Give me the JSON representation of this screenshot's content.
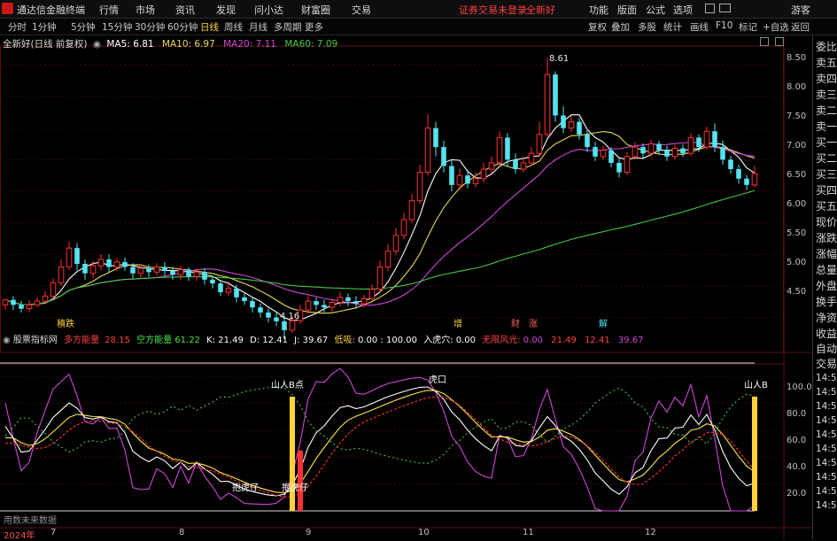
{
  "titlebar": {
    "app_name": "通达信金融终端",
    "menus": [
      "行情",
      "市场",
      "资讯",
      "发现",
      "问小达",
      "财富圈",
      "交易"
    ],
    "alert": "证券交易未登录",
    "stock": "全新好",
    "right_menus": [
      "功能",
      "版面",
      "公式",
      "选项"
    ],
    "user": "游客"
  },
  "toolbar": {
    "periods": [
      "分时",
      "1分钟",
      "5分钟",
      "15分钟",
      "30分钟",
      "60分钟",
      "日线",
      "周线",
      "月线",
      "多周期",
      "更多"
    ],
    "active_period": "日线",
    "right_buttons": [
      "复权",
      "叠加",
      "多股",
      "统计",
      "画线",
      "F10",
      "标记",
      "+自选",
      "返回"
    ]
  },
  "legend_main": {
    "title": "全新好(日线 前复权)",
    "ma5": "MA5: 6.81",
    "ma10": "MA10: 6.97",
    "ma20": "MA20: 7.11",
    "ma60": "MA60: 7.09"
  },
  "legend_ind": {
    "name": "股票指标网",
    "a_label": "多方能量",
    "a_val": "28.15",
    "b_label": "空方能量",
    "b_val": "61.22",
    "k": "K: 21.49",
    "d": "D: 12.41",
    "j": "J: 39.67",
    "low_label": "低吸:",
    "low_val": "0.00",
    "low_val2": ": 100.00",
    "entry_label": "入虎穴:",
    "entry_val": "0.00",
    "risk_label": "无限风光:",
    "risk_val": "0.00",
    "v1": "21.49",
    "v2": "12.41",
    "v3": "39.67"
  },
  "right_panel": {
    "top": [
      "委比",
      "卖五",
      "卖四",
      "卖三",
      "卖二",
      "卖一",
      "买一",
      "买二",
      "买三",
      "买四",
      "买五",
      "现价",
      "涨跌",
      "涨幅",
      "总量",
      "外盘",
      "换手",
      "净资",
      "收益"
    ],
    "bottom": [
      "自动",
      "交易"
    ],
    "times": [
      "14:55",
      "14:55",
      "14:55",
      "14:55",
      "14:55",
      "14:55",
      "14:55",
      "14:55",
      "14:55",
      "14:55"
    ]
  },
  "markers": {
    "event1": "積跌",
    "event2": "增",
    "event3": "财",
    "event4": "涨",
    "event5": "解",
    "high_label": "8.61",
    "low_label": "4.16",
    "sig1": "山人B点",
    "sig2": "山人B",
    "sig3": "抱虎仔",
    "sig4": "抱虎仔",
    "sig5": "虎口",
    "footer": "用数未来数据"
  },
  "chart_data": [
    {
      "type": "candlestick",
      "title": "全新好(日线 前复权)",
      "ylim": [
        4.2,
        8.8
      ],
      "y_ticks": [
        4.5,
        5.0,
        5.5,
        6.0,
        6.5,
        7.0,
        7.5,
        8.0,
        8.5
      ],
      "annotations": [
        {
          "label": "8.61",
          "value": 8.61
        },
        {
          "label": "4.16",
          "value": 4.16
        }
      ],
      "series": [
        {
          "name": "MA5",
          "color": "#ffffff"
        },
        {
          "name": "MA10",
          "color": "#e8d85a"
        },
        {
          "name": "MA20",
          "color": "#d046d8"
        },
        {
          "name": "MA60",
          "color": "#46c846"
        }
      ],
      "candles": [
        [
          4.7,
          4.78,
          4.62,
          4.8
        ],
        [
          4.78,
          4.7,
          4.62,
          4.84
        ],
        [
          4.7,
          4.64,
          4.58,
          4.76
        ],
        [
          4.64,
          4.7,
          4.58,
          4.78
        ],
        [
          4.7,
          4.76,
          4.66,
          4.82
        ],
        [
          4.76,
          4.84,
          4.72,
          4.92
        ],
        [
          4.84,
          5.05,
          4.8,
          5.12
        ],
        [
          5.05,
          5.3,
          5.0,
          5.42
        ],
        [
          5.3,
          5.6,
          5.25,
          5.7
        ],
        [
          5.6,
          5.35,
          5.25,
          5.68
        ],
        [
          5.35,
          5.2,
          5.1,
          5.42
        ],
        [
          5.2,
          5.32,
          5.12,
          5.4
        ],
        [
          5.32,
          5.42,
          5.25,
          5.5
        ],
        [
          5.42,
          5.3,
          5.22,
          5.5
        ],
        [
          5.3,
          5.38,
          5.24,
          5.44
        ],
        [
          5.38,
          5.3,
          5.24,
          5.45
        ],
        [
          5.3,
          5.2,
          5.12,
          5.36
        ],
        [
          5.2,
          5.28,
          5.12,
          5.34
        ],
        [
          5.28,
          5.22,
          5.14,
          5.34
        ],
        [
          5.22,
          5.3,
          5.16,
          5.36
        ],
        [
          5.3,
          5.24,
          5.16,
          5.38
        ],
        [
          5.24,
          5.18,
          5.1,
          5.3
        ],
        [
          5.18,
          5.26,
          5.1,
          5.32
        ],
        [
          5.26,
          5.15,
          5.08,
          5.3
        ],
        [
          5.15,
          5.22,
          5.08,
          5.28
        ],
        [
          5.22,
          5.1,
          5.02,
          5.28
        ],
        [
          5.1,
          5.04,
          4.96,
          5.16
        ],
        [
          5.04,
          4.9,
          4.84,
          5.1
        ],
        [
          4.9,
          4.96,
          4.84,
          5.04
        ],
        [
          4.96,
          4.82,
          4.74,
          5.02
        ],
        [
          4.82,
          4.76,
          4.7,
          4.9
        ],
        [
          4.76,
          4.66,
          4.58,
          4.82
        ],
        [
          4.66,
          4.58,
          4.5,
          4.72
        ],
        [
          4.58,
          4.5,
          4.42,
          4.64
        ],
        [
          4.5,
          4.44,
          4.36,
          4.58
        ],
        [
          4.44,
          4.3,
          4.16,
          4.5
        ],
        [
          4.3,
          4.45,
          4.26,
          4.52
        ],
        [
          4.45,
          4.62,
          4.4,
          4.7
        ],
        [
          4.62,
          4.76,
          4.56,
          4.84
        ],
        [
          4.76,
          4.7,
          4.62,
          4.82
        ],
        [
          4.7,
          4.66,
          4.58,
          4.78
        ],
        [
          4.66,
          4.74,
          4.6,
          4.8
        ],
        [
          4.74,
          4.82,
          4.68,
          4.9
        ],
        [
          4.82,
          4.76,
          4.68,
          4.88
        ],
        [
          4.76,
          4.72,
          4.64,
          4.84
        ],
        [
          4.72,
          4.8,
          4.66,
          4.86
        ],
        [
          4.8,
          4.95,
          4.76,
          5.02
        ],
        [
          4.95,
          5.3,
          4.9,
          5.4
        ],
        [
          5.3,
          5.55,
          5.24,
          5.66
        ],
        [
          5.55,
          5.8,
          5.5,
          5.92
        ],
        [
          5.8,
          6.05,
          5.74,
          6.16
        ],
        [
          6.05,
          6.35,
          6.0,
          6.46
        ],
        [
          6.35,
          6.8,
          6.3,
          6.92
        ],
        [
          6.8,
          7.5,
          6.75,
          7.72
        ],
        [
          7.5,
          7.2,
          7.05,
          7.6
        ],
        [
          7.2,
          6.9,
          6.8,
          7.3
        ],
        [
          6.9,
          6.6,
          6.5,
          7.0
        ],
        [
          6.6,
          6.75,
          6.52,
          6.86
        ],
        [
          6.75,
          6.62,
          6.55,
          6.84
        ],
        [
          6.62,
          6.7,
          6.56,
          6.8
        ],
        [
          6.7,
          6.85,
          6.64,
          6.95
        ],
        [
          6.85,
          6.95,
          6.78,
          7.05
        ],
        [
          6.95,
          7.35,
          6.9,
          7.45
        ],
        [
          7.35,
          7.0,
          6.9,
          7.42
        ],
        [
          7.0,
          6.85,
          6.78,
          7.1
        ],
        [
          6.85,
          6.95,
          6.8,
          7.05
        ],
        [
          6.95,
          7.1,
          6.9,
          7.2
        ],
        [
          7.1,
          7.4,
          7.05,
          7.6
        ],
        [
          7.4,
          8.35,
          7.35,
          8.61
        ],
        [
          8.35,
          7.7,
          7.6,
          8.4
        ],
        [
          7.7,
          7.5,
          7.42,
          7.85
        ],
        [
          7.5,
          7.6,
          7.44,
          7.7
        ],
        [
          7.6,
          7.4,
          7.32,
          7.66
        ],
        [
          7.4,
          7.2,
          7.12,
          7.48
        ],
        [
          7.2,
          7.05,
          6.98,
          7.28
        ],
        [
          7.05,
          7.15,
          7.0,
          7.22
        ],
        [
          7.15,
          6.95,
          6.88,
          7.2
        ],
        [
          6.95,
          6.8,
          6.72,
          7.02
        ],
        [
          6.8,
          7.05,
          6.76,
          7.12
        ],
        [
          7.05,
          7.2,
          7.0,
          7.28
        ],
        [
          7.2,
          7.1,
          7.02,
          7.26
        ],
        [
          7.1,
          7.25,
          7.04,
          7.32
        ],
        [
          7.25,
          7.15,
          7.08,
          7.3
        ],
        [
          7.15,
          7.05,
          6.98,
          7.22
        ],
        [
          7.05,
          7.18,
          7.0,
          7.24
        ],
        [
          7.18,
          7.1,
          7.04,
          7.24
        ],
        [
          7.1,
          7.35,
          7.06,
          7.42
        ],
        [
          7.35,
          7.2,
          7.12,
          7.4
        ],
        [
          7.2,
          7.45,
          7.16,
          7.52
        ],
        [
          7.45,
          7.2,
          7.12,
          7.58
        ],
        [
          7.2,
          7.0,
          6.92,
          7.3
        ],
        [
          7.0,
          6.85,
          6.78,
          7.06
        ],
        [
          6.85,
          6.7,
          6.62,
          6.92
        ],
        [
          6.7,
          6.6,
          6.52,
          6.76
        ],
        [
          6.6,
          6.78,
          6.56,
          6.9
        ]
      ]
    },
    {
      "type": "line",
      "ylim": [
        0,
        110
      ],
      "y_ticks": [
        20.0,
        40.0,
        60.0,
        80.0,
        100.0
      ],
      "series": [
        {
          "name": "K",
          "color": "#ffffff"
        },
        {
          "name": "D",
          "color": "#ffe84a"
        },
        {
          "name": "J",
          "color": "#d046d8"
        }
      ]
    }
  ],
  "x_axis": {
    "labels": [
      "2024年",
      "7",
      "8",
      "9",
      "10",
      "11",
      "12"
    ]
  },
  "colors": {
    "up": "#ff3030",
    "down": "#54e4f0",
    "bg": "#000000",
    "grid": "#5a1010"
  }
}
